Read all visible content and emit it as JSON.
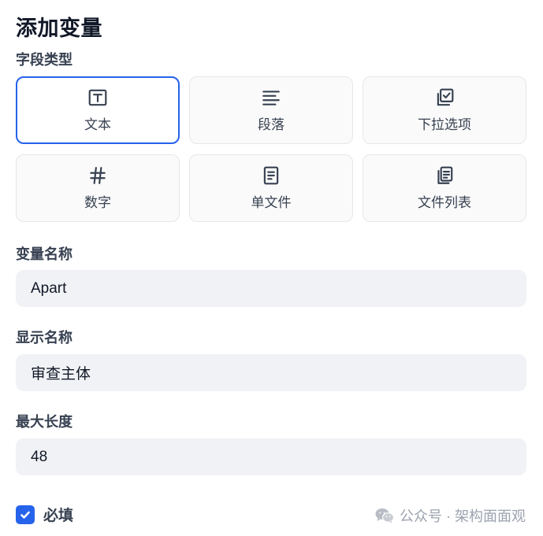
{
  "dialog": {
    "title": "添加变量"
  },
  "field_type": {
    "label": "字段类型",
    "selected": "文本",
    "options": [
      {
        "label": "文本",
        "icon": "text-box-icon"
      },
      {
        "label": "段落",
        "icon": "paragraph-lines-icon"
      },
      {
        "label": "下拉选项",
        "icon": "select-options-icon"
      },
      {
        "label": "数字",
        "icon": "hash-icon"
      },
      {
        "label": "单文件",
        "icon": "file-icon"
      },
      {
        "label": "文件列表",
        "icon": "file-list-icon"
      }
    ]
  },
  "variable_name": {
    "label": "变量名称",
    "value": "Apart"
  },
  "display_name": {
    "label": "显示名称",
    "value": "审查主体"
  },
  "max_length": {
    "label": "最大长度",
    "value": "48"
  },
  "required": {
    "label": "必填",
    "checked": true
  },
  "watermark": {
    "text": "公众号 · 架构面面观"
  },
  "colors": {
    "accent": "#2563eb",
    "input_bg": "#f1f2f5",
    "card_bg": "#fafafa"
  }
}
